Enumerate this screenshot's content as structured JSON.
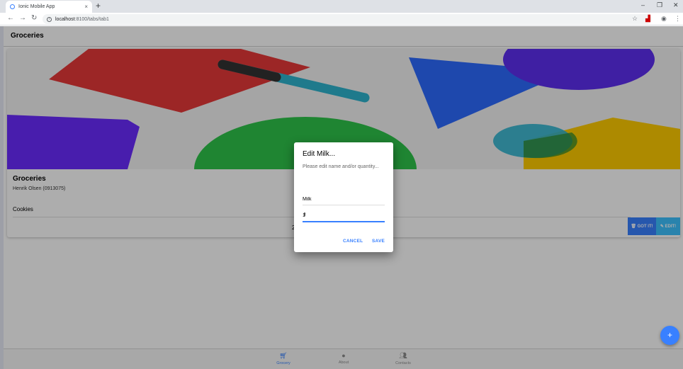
{
  "browser": {
    "tab_title": "Ionic Mobile App",
    "tab_close": "×",
    "new_tab": "+",
    "url_host": "localhost",
    "url_path": ":8100/tabs/tab1",
    "controls": {
      "minimize": "–",
      "restore": "❐",
      "close": "✕"
    }
  },
  "app": {
    "page_title": "Groceries",
    "card": {
      "title": "Groceries",
      "subtitle": "Henrik Olsen (0913075)",
      "item_name": "Cookies",
      "item_qty": "2",
      "got_it_label": "🗑 GOT IT!",
      "edit_label": "✎ EDIT!"
    },
    "tabs": [
      {
        "label": "Grocery",
        "icon": "cart-icon",
        "active": true
      },
      {
        "label": "About",
        "icon": "info-icon",
        "active": false
      },
      {
        "label": "Contacts",
        "icon": "people-icon",
        "active": false
      }
    ],
    "fab_label": "+"
  },
  "dialog": {
    "header": "Edit Milk...",
    "message": "Please edit name and/or quantity...",
    "name_value": "Milk",
    "qty_value": "1",
    "cancel_label": "CANCEL",
    "save_label": "SAVE"
  },
  "colors": {
    "primary": "#3880ff",
    "secondary": "#3dc2ff"
  }
}
